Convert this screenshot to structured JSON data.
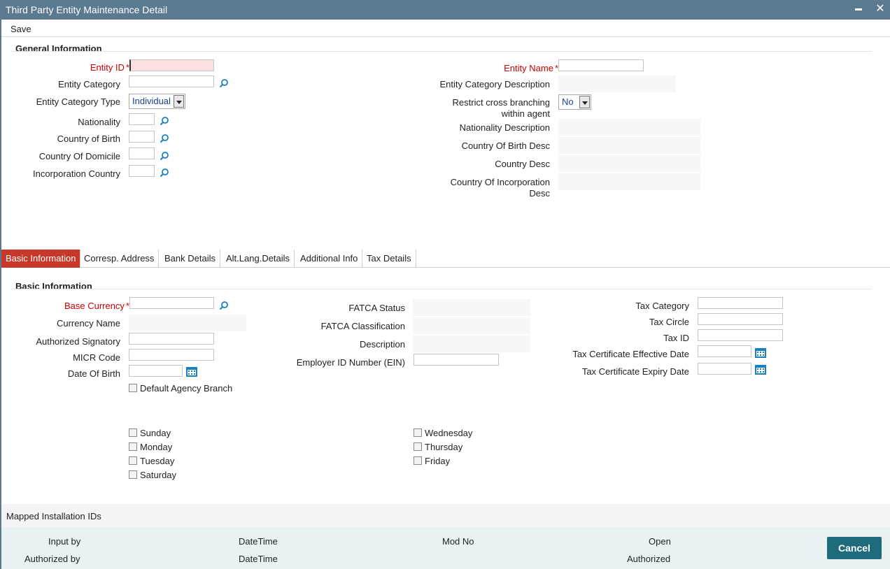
{
  "window": {
    "title": "Third Party Entity Maintenance Detail",
    "minimize": "",
    "close": "✕"
  },
  "menu": {
    "save": "Save"
  },
  "general": {
    "title": "General Information",
    "entity_id_label": "Entity ID",
    "entity_category_label": "Entity Category",
    "entity_category_type_label": "Entity Category Type",
    "entity_category_type_value": "Individual",
    "nationality_label": "Nationality",
    "country_of_birth_label": "Country of Birth",
    "country_of_domicile_label": "Country Of Domicile",
    "incorporation_country_label": "Incorporation Country",
    "entity_name_label": "Entity Name",
    "entity_category_desc_label": "Entity Category Description",
    "restrict_cross_branching_label": "Restrict cross branching within agent",
    "restrict_cross_branching_value": "No",
    "nationality_desc_label": "Nationality Description",
    "country_of_birth_desc_label": "Country Of Birth Desc",
    "country_desc_label": "Country Desc",
    "country_of_incorporation_desc_label": "Country Of Incorporation Desc"
  },
  "tabs": [
    {
      "label": "Basic Information"
    },
    {
      "label": "Corresp. Address"
    },
    {
      "label": "Bank Details"
    },
    {
      "label": "Alt.Lang.Details"
    },
    {
      "label": "Additional Info"
    },
    {
      "label": "Tax Details"
    }
  ],
  "basic": {
    "title": "Basic Information",
    "base_currency_label": "Base Currency",
    "currency_name_label": "Currency Name",
    "authorized_signatory_label": "Authorized Signatory",
    "micr_code_label": "MICR Code",
    "date_of_birth_label": "Date Of Birth",
    "default_agency_branch_label": "Default Agency Branch",
    "fatca_status_label": "FATCA Status",
    "fatca_classification_label": "FATCA Classification",
    "description_label": "Description",
    "ein_label": "Employer ID Number (EIN)",
    "tax_category_label": "Tax Category",
    "tax_circle_label": "Tax Circle",
    "tax_id_label": "Tax ID",
    "tax_cert_effective_label": "Tax Certificate Effective Date",
    "tax_cert_expiry_label": "Tax Certificate Expiry Date",
    "days": {
      "sunday": "Sunday",
      "monday": "Monday",
      "tuesday": "Tuesday",
      "saturday": "Saturday",
      "wednesday": "Wednesday",
      "thursday": "Thursday",
      "friday": "Friday"
    }
  },
  "mapped": {
    "label": "Mapped Installation IDs"
  },
  "footer": {
    "input_by": "Input by",
    "authorized_by": "Authorized by",
    "datetime_1": "DateTime",
    "datetime_2": "DateTime",
    "mod_no": "Mod No",
    "open": "Open",
    "authorized": "Authorized",
    "cancel": "Cancel"
  },
  "colors": {
    "titlebar": "#5b7a8f",
    "active_tab": "#c8382a",
    "required": "#cc0000",
    "cancel_button": "#1e6b7b",
    "footer_bg": "#eaf1f3"
  }
}
